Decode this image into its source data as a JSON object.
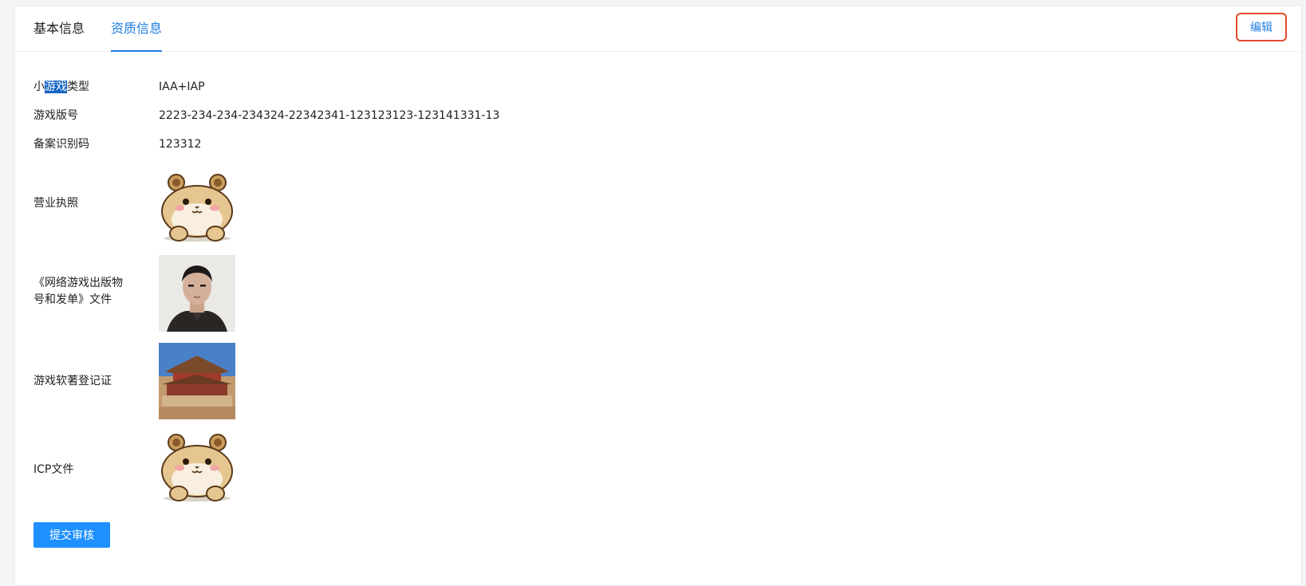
{
  "tabs": {
    "basic": "基本信息",
    "qualification": "资质信息"
  },
  "edit_label": "编辑",
  "fields": {
    "type": {
      "label_pre": "小",
      "label_hl": "游戏",
      "label_post": "类型",
      "value": "IAA+IAP"
    },
    "version": {
      "label": "游戏版号",
      "value": "2223-234-234-234324-22342341-123123123-123141331-13"
    },
    "record": {
      "label": "备案识别码",
      "value": "123312"
    },
    "license": {
      "label": "营业执照"
    },
    "publication": {
      "label_line1": "《网络游戏出版物",
      "label_line2": "号和发单》文件"
    },
    "copyright": {
      "label": "游戏软著登记证"
    },
    "icp": {
      "label": "ICP文件"
    }
  },
  "submit_label": "提交审核",
  "colors": {
    "accent": "#1e7fe0",
    "edit_border": "#e0492b",
    "submit_bg": "#1e90ff"
  }
}
